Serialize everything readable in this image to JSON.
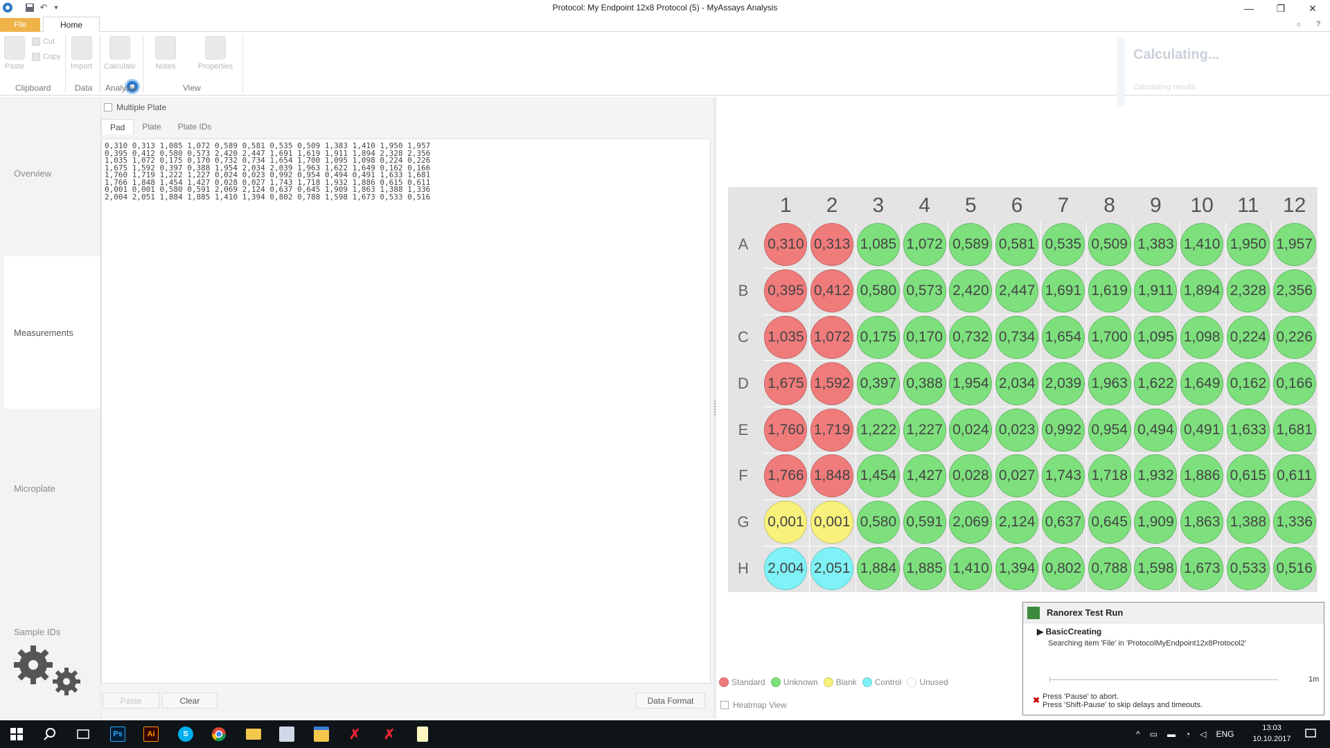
{
  "window": {
    "title": "Protocol: My Endpoint 12x8 Protocol (5) - MyAssays Analysis"
  },
  "ribbon": {
    "tabs": {
      "file": "File",
      "home": "Home"
    },
    "buttons": {
      "paste": "Paste",
      "cut": "Cut",
      "copy": "Copy",
      "import": "Import",
      "calculate": "Calculate",
      "notes": "Notes",
      "properties": "Properties"
    },
    "groups": {
      "clipboard": "Clipboard",
      "data": "Data",
      "analysis": "Analysis",
      "view": "View"
    },
    "status": {
      "title": "Calculating...",
      "sub": "Calculating results"
    }
  },
  "nav": {
    "items": [
      "Overview",
      "Measurements",
      "Microplate",
      "Sample IDs"
    ],
    "active": "Measurements"
  },
  "data_panel": {
    "multiple_plate_label": "Multiple Plate",
    "tabs": [
      "Pad",
      "Plate",
      "Plate IDs"
    ],
    "text": "0,310 0,313 1,085 1,072 0,589 0,581 0,535 0,509 1,383 1,410 1,950 1,957\n0,395 0,412 0,580 0,573 2,420 2,447 1,691 1,619 1,911 1,894 2,328 2,356\n1,035 1,072 0,175 0,170 0,732 0,734 1,654 1,700 1,095 1,098 0,224 0,226\n1,675 1,592 0,397 0,388 1,954 2,034 2,039 1,963 1,622 1,649 0,162 0,166\n1,760 1,719 1,222 1,227 0,024 0,023 0,992 0,954 0,494 0,491 1,633 1,681\n1,766 1,848 1,454 1,427 0,028 0,027 1,743 1,718 1,932 1,886 0,615 0,611\n0,001 0,001 0,580 0,591 2,069 2,124 0,637 0,645 1,909 1,863 1,388 1,336\n2,004 2,051 1,884 1,885 1,410 1,394 0,802 0,788 1,598 1,673 0,533 0,516",
    "buttons": {
      "paste": "Paste",
      "clear": "Clear",
      "data_format": "Data Format"
    }
  },
  "plate": {
    "columns": [
      "1",
      "2",
      "3",
      "4",
      "5",
      "6",
      "7",
      "8",
      "9",
      "10",
      "11",
      "12"
    ],
    "rows": [
      "A",
      "B",
      "C",
      "D",
      "E",
      "F",
      "G",
      "H"
    ],
    "colors": {
      "standard": "#f07b7b",
      "unknown": "#7de07d",
      "blank": "#f8f27c",
      "control": "#7ef2f7"
    },
    "wells": [
      [
        "0,310",
        "0,313",
        "1,085",
        "1,072",
        "0,589",
        "0,581",
        "0,535",
        "0,509",
        "1,383",
        "1,410",
        "1,950",
        "1,957"
      ],
      [
        "0,395",
        "0,412",
        "0,580",
        "0,573",
        "2,420",
        "2,447",
        "1,691",
        "1,619",
        "1,911",
        "1,894",
        "2,328",
        "2,356"
      ],
      [
        "1,035",
        "1,072",
        "0,175",
        "0,170",
        "0,732",
        "0,734",
        "1,654",
        "1,700",
        "1,095",
        "1,098",
        "0,224",
        "0,226"
      ],
      [
        "1,675",
        "1,592",
        "0,397",
        "0,388",
        "1,954",
        "2,034",
        "2,039",
        "1,963",
        "1,622",
        "1,649",
        "0,162",
        "0,166"
      ],
      [
        "1,760",
        "1,719",
        "1,222",
        "1,227",
        "0,024",
        "0,023",
        "0,992",
        "0,954",
        "0,494",
        "0,491",
        "1,633",
        "1,681"
      ],
      [
        "1,766",
        "1,848",
        "1,454",
        "1,427",
        "0,028",
        "0,027",
        "1,743",
        "1,718",
        "1,932",
        "1,886",
        "0,615",
        "0,611"
      ],
      [
        "0,001",
        "0,001",
        "0,580",
        "0,591",
        "2,069",
        "2,124",
        "0,637",
        "0,645",
        "1,909",
        "1,863",
        "1,388",
        "1,336"
      ],
      [
        "2,004",
        "2,051",
        "1,884",
        "1,885",
        "1,410",
        "1,394",
        "0,802",
        "0,788",
        "1,598",
        "1,673",
        "0,533",
        "0,516"
      ]
    ],
    "types": [
      [
        "standard",
        "standard",
        "unknown",
        "unknown",
        "unknown",
        "unknown",
        "unknown",
        "unknown",
        "unknown",
        "unknown",
        "unknown",
        "unknown"
      ],
      [
        "standard",
        "standard",
        "unknown",
        "unknown",
        "unknown",
        "unknown",
        "unknown",
        "unknown",
        "unknown",
        "unknown",
        "unknown",
        "unknown"
      ],
      [
        "standard",
        "standard",
        "unknown",
        "unknown",
        "unknown",
        "unknown",
        "unknown",
        "unknown",
        "unknown",
        "unknown",
        "unknown",
        "unknown"
      ],
      [
        "standard",
        "standard",
        "unknown",
        "unknown",
        "unknown",
        "unknown",
        "unknown",
        "unknown",
        "unknown",
        "unknown",
        "unknown",
        "unknown"
      ],
      [
        "standard",
        "standard",
        "unknown",
        "unknown",
        "unknown",
        "unknown",
        "unknown",
        "unknown",
        "unknown",
        "unknown",
        "unknown",
        "unknown"
      ],
      [
        "standard",
        "standard",
        "unknown",
        "unknown",
        "unknown",
        "unknown",
        "unknown",
        "unknown",
        "unknown",
        "unknown",
        "unknown",
        "unknown"
      ],
      [
        "blank",
        "blank",
        "unknown",
        "unknown",
        "unknown",
        "unknown",
        "unknown",
        "unknown",
        "unknown",
        "unknown",
        "unknown",
        "unknown"
      ],
      [
        "control",
        "control",
        "unknown",
        "unknown",
        "unknown",
        "unknown",
        "unknown",
        "unknown",
        "unknown",
        "unknown",
        "unknown",
        "unknown"
      ]
    ]
  },
  "legend": {
    "standard": "Standard",
    "unknown": "Unknown",
    "blank": "Blank",
    "control": "Control",
    "unused": "Unused",
    "heatmap": "Heatmap View"
  },
  "ranorex": {
    "title": "Ranorex Test Run",
    "test_case": "BasicCreating",
    "description": "Searching item 'File' in 'ProtocolMyEndpoint12x8Protocol2'",
    "time": "1m",
    "hint1": "Press 'Pause' to abort.",
    "hint2": "Press 'Shift-Pause' to skip delays and timeouts."
  },
  "taskbar": {
    "apps": [
      "start-icon",
      "search-icon",
      "task-view-icon",
      "photoshop-icon",
      "illustrator-icon",
      "skype-icon",
      "chrome-icon",
      "file-explorer-icon",
      "snipping-icon",
      "store-icon",
      "ranorex-icon",
      "ranorex-studio-icon",
      "notepad-icon"
    ],
    "lang": "ENG",
    "time": "13:03",
    "date": "10.10.2017"
  }
}
